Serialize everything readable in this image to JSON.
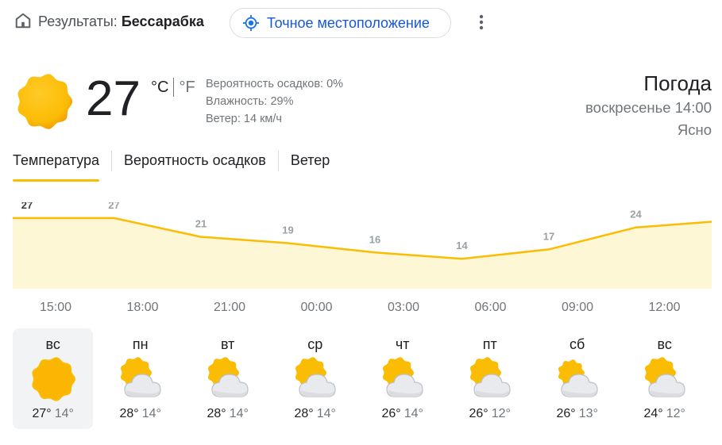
{
  "header": {
    "results_label": "Результаты:",
    "location": "Бессарабка",
    "location_button": "Точное местоположение"
  },
  "current": {
    "icon": "sun-icon",
    "temperature": "27",
    "unit_c": "°C",
    "unit_f": "°F",
    "precipitation": "Вероятность осадков: 0%",
    "humidity": "Влажность: 29%",
    "wind": "Ветер: 14 км/ч",
    "title": "Погода",
    "datetime": "воскресенье 14:00",
    "condition": "Ясно"
  },
  "tabs": [
    {
      "label": "Температура",
      "active": true
    },
    {
      "label": "Вероятность осадков",
      "active": false
    },
    {
      "label": "Ветер",
      "active": false
    }
  ],
  "chart_data": {
    "type": "area",
    "x": [
      "15:00",
      "18:00",
      "21:00",
      "00:00",
      "03:00",
      "06:00",
      "09:00",
      "12:00"
    ],
    "values": [
      27,
      27,
      21,
      19,
      16,
      14,
      17,
      24
    ],
    "tick_labels": [
      "15:00",
      "18:00",
      "21:00",
      "00:00",
      "03:00",
      "06:00",
      "09:00",
      "12:00"
    ],
    "colors": {
      "line": "#fbbc04",
      "fill": "#fef7d6"
    }
  },
  "forecast": [
    {
      "day": "вс",
      "icon": "sun-icon",
      "high": "27°",
      "low": "14°",
      "selected": true
    },
    {
      "day": "пн",
      "icon": "partly-cloudy-icon",
      "high": "28°",
      "low": "14°",
      "selected": false
    },
    {
      "day": "вт",
      "icon": "partly-cloudy-icon",
      "high": "28°",
      "low": "14°",
      "selected": false
    },
    {
      "day": "ср",
      "icon": "partly-cloudy-icon",
      "high": "28°",
      "low": "14°",
      "selected": false
    },
    {
      "day": "чт",
      "icon": "partly-cloudy-icon",
      "high": "26°",
      "low": "14°",
      "selected": false
    },
    {
      "day": "пт",
      "icon": "partly-cloudy-icon",
      "high": "26°",
      "low": "12°",
      "selected": false
    },
    {
      "day": "сб",
      "icon": "mostly-cloudy-icon",
      "high": "26°",
      "low": "13°",
      "selected": false
    },
    {
      "day": "вс",
      "icon": "partly-cloudy-icon",
      "high": "24°",
      "low": "12°",
      "selected": false
    }
  ]
}
